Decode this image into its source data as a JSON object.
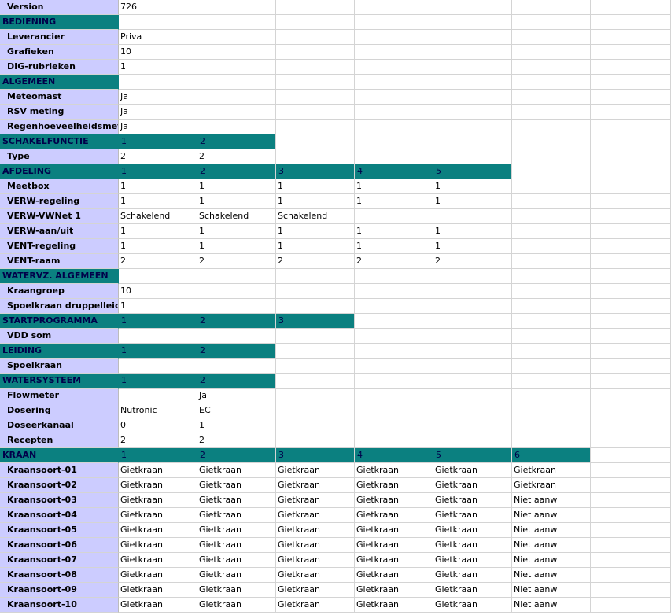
{
  "columns": [
    "label",
    "c1",
    "c2",
    "c3",
    "c4",
    "c5",
    "c6",
    "c7"
  ],
  "rows": [
    {
      "type": "label",
      "cells": [
        "Version",
        "726",
        "",
        "",
        "",
        "",
        "",
        ""
      ]
    },
    {
      "type": "section",
      "cells": [
        "BEDIENING",
        "",
        "",
        "",
        "",
        "",
        "",
        ""
      ],
      "filled": 1
    },
    {
      "type": "label",
      "cells": [
        "Leverancier",
        "Priva",
        "",
        "",
        "",
        "",
        "",
        ""
      ]
    },
    {
      "type": "label",
      "cells": [
        "Grafieken",
        "10",
        "",
        "",
        "",
        "",
        "",
        ""
      ]
    },
    {
      "type": "label",
      "cells": [
        "DIG-rubrieken",
        "1",
        "",
        "",
        "",
        "",
        "",
        ""
      ]
    },
    {
      "type": "section",
      "cells": [
        "ALGEMEEN",
        "",
        "",
        "",
        "",
        "",
        "",
        ""
      ],
      "filled": 1
    },
    {
      "type": "label",
      "cells": [
        "Meteomast",
        "Ja",
        "",
        "",
        "",
        "",
        "",
        ""
      ]
    },
    {
      "type": "label",
      "cells": [
        "RSV meting",
        "Ja",
        "",
        "",
        "",
        "",
        "",
        ""
      ]
    },
    {
      "type": "label",
      "cells": [
        "Regenhoeveelheidsmeter",
        "Ja",
        "",
        "",
        "",
        "",
        "",
        ""
      ]
    },
    {
      "type": "section",
      "cells": [
        "SCHAKELFUNCTIE",
        "1",
        "2",
        "",
        "",
        "",
        "",
        ""
      ],
      "filled": 3
    },
    {
      "type": "label",
      "cells": [
        "Type",
        "2",
        "2",
        "",
        "",
        "",
        "",
        ""
      ]
    },
    {
      "type": "section",
      "cells": [
        "AFDELING",
        "1",
        "2",
        "3",
        "4",
        "5",
        "",
        ""
      ],
      "filled": 6
    },
    {
      "type": "label",
      "cells": [
        "Meetbox",
        "1",
        "1",
        "1",
        "1",
        "1",
        "",
        ""
      ]
    },
    {
      "type": "label",
      "cells": [
        "VERW-regeling",
        "1",
        "1",
        "1",
        "1",
        "1",
        "",
        ""
      ]
    },
    {
      "type": "label",
      "cells": [
        "VERW-VWNet 1",
        "Schakelend",
        "Schakelend",
        "Schakelend",
        "",
        "",
        "",
        ""
      ]
    },
    {
      "type": "label",
      "cells": [
        "VERW-aan/uit",
        "1",
        "1",
        "1",
        "1",
        "1",
        "",
        ""
      ]
    },
    {
      "type": "label",
      "cells": [
        "VENT-regeling",
        "1",
        "1",
        "1",
        "1",
        "1",
        "",
        ""
      ]
    },
    {
      "type": "label",
      "cells": [
        "VENT-raam",
        "2",
        "2",
        "2",
        "2",
        "2",
        "",
        ""
      ]
    },
    {
      "type": "section",
      "cells": [
        "WATERVZ. ALGEMEEN",
        "",
        "",
        "",
        "",
        "",
        "",
        ""
      ],
      "filled": 1
    },
    {
      "type": "label",
      "cells": [
        "Kraangroep",
        "10",
        "",
        "",
        "",
        "",
        "",
        ""
      ]
    },
    {
      "type": "label",
      "cells": [
        "Spoelkraan druppelleiding",
        "1",
        "",
        "",
        "",
        "",
        "",
        ""
      ]
    },
    {
      "type": "section",
      "cells": [
        "STARTPROGRAMMA",
        "1",
        "2",
        "3",
        "",
        "",
        "",
        ""
      ],
      "filled": 4
    },
    {
      "type": "label",
      "cells": [
        "VDD som",
        "",
        "",
        "",
        "",
        "",
        "",
        ""
      ]
    },
    {
      "type": "section",
      "cells": [
        "LEIDING",
        "1",
        "2",
        "",
        "",
        "",
        "",
        ""
      ],
      "filled": 3
    },
    {
      "type": "label",
      "cells": [
        "Spoelkraan",
        "",
        "",
        "",
        "",
        "",
        "",
        ""
      ]
    },
    {
      "type": "section",
      "cells": [
        "WATERSYSTEEM",
        "1",
        "2",
        "",
        "",
        "",
        "",
        ""
      ],
      "filled": 3
    },
    {
      "type": "label",
      "cells": [
        "Flowmeter",
        "",
        "Ja",
        "",
        "",
        "",
        "",
        ""
      ]
    },
    {
      "type": "label",
      "cells": [
        "Dosering",
        "Nutronic",
        "EC",
        "",
        "",
        "",
        "",
        ""
      ]
    },
    {
      "type": "label",
      "cells": [
        "Doseerkanaal",
        "0",
        "1",
        "",
        "",
        "",
        "",
        ""
      ]
    },
    {
      "type": "label",
      "cells": [
        "Recepten",
        "2",
        "2",
        "",
        "",
        "",
        "",
        ""
      ]
    },
    {
      "type": "section",
      "cells": [
        "KRAAN",
        "1",
        "2",
        "3",
        "4",
        "5",
        "6",
        ""
      ],
      "filled": 7
    },
    {
      "type": "label",
      "cells": [
        "Kraansoort-01",
        "Gietkraan",
        "Gietkraan",
        "Gietkraan",
        "Gietkraan",
        "Gietkraan",
        "Gietkraan",
        ""
      ]
    },
    {
      "type": "label",
      "cells": [
        "Kraansoort-02",
        "Gietkraan",
        "Gietkraan",
        "Gietkraan",
        "Gietkraan",
        "Gietkraan",
        "Gietkraan",
        ""
      ]
    },
    {
      "type": "label",
      "cells": [
        "Kraansoort-03",
        "Gietkraan",
        "Gietkraan",
        "Gietkraan",
        "Gietkraan",
        "Gietkraan",
        "Niet aanw",
        ""
      ]
    },
    {
      "type": "label",
      "cells": [
        "Kraansoort-04",
        "Gietkraan",
        "Gietkraan",
        "Gietkraan",
        "Gietkraan",
        "Gietkraan",
        "Niet aanw",
        ""
      ]
    },
    {
      "type": "label",
      "cells": [
        "Kraansoort-05",
        "Gietkraan",
        "Gietkraan",
        "Gietkraan",
        "Gietkraan",
        "Gietkraan",
        "Niet aanw",
        ""
      ]
    },
    {
      "type": "label",
      "cells": [
        "Kraansoort-06",
        "Gietkraan",
        "Gietkraan",
        "Gietkraan",
        "Gietkraan",
        "Gietkraan",
        "Niet aanw",
        ""
      ]
    },
    {
      "type": "label",
      "cells": [
        "Kraansoort-07",
        "Gietkraan",
        "Gietkraan",
        "Gietkraan",
        "Gietkraan",
        "Gietkraan",
        "Niet aanw",
        ""
      ]
    },
    {
      "type": "label",
      "cells": [
        "Kraansoort-08",
        "Gietkraan",
        "Gietkraan",
        "Gietkraan",
        "Gietkraan",
        "Gietkraan",
        "Niet aanw",
        ""
      ]
    },
    {
      "type": "label",
      "cells": [
        "Kraansoort-09",
        "Gietkraan",
        "Gietkraan",
        "Gietkraan",
        "Gietkraan",
        "Gietkraan",
        "Niet aanw",
        ""
      ]
    },
    {
      "type": "label",
      "cells": [
        "Kraansoort-10",
        "Gietkraan",
        "Gietkraan",
        "Gietkraan",
        "Gietkraan",
        "Gietkraan",
        "Niet aanw",
        ""
      ]
    }
  ]
}
